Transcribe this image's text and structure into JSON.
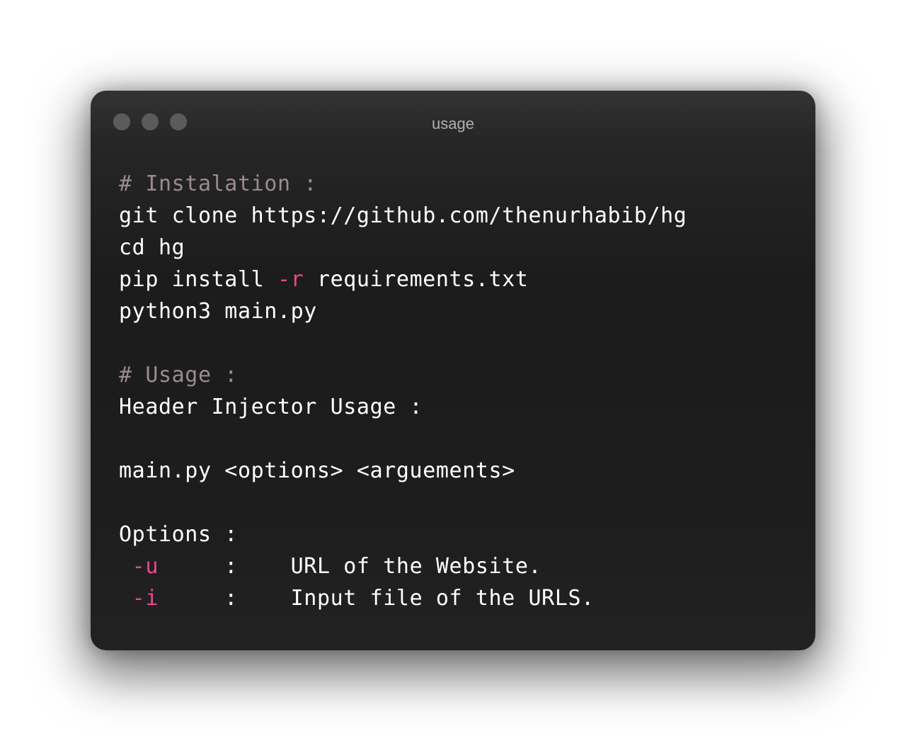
{
  "window": {
    "title": "usage",
    "controls": [
      "close",
      "minimize",
      "maximize"
    ]
  },
  "code": {
    "lines": [
      [
        {
          "kind": "comment",
          "text": "# Instalation :"
        }
      ],
      [
        {
          "kind": "plain",
          "text": "git clone https://github.com/thenurhabib/hg"
        }
      ],
      [
        {
          "kind": "plain",
          "text": "cd hg"
        }
      ],
      [
        {
          "kind": "plain",
          "text": "pip install "
        },
        {
          "kind": "flag",
          "text": "-r"
        },
        {
          "kind": "plain",
          "text": " requirements.txt"
        }
      ],
      [
        {
          "kind": "plain",
          "text": "python3 main.py"
        }
      ],
      [],
      [
        {
          "kind": "comment",
          "text": "# Usage :"
        }
      ],
      [
        {
          "kind": "plain",
          "text": "Header Injector Usage :"
        }
      ],
      [],
      [
        {
          "kind": "plain",
          "text": "main.py <options> <arguements>"
        }
      ],
      [],
      [
        {
          "kind": "plain",
          "text": "Options :"
        }
      ],
      [
        {
          "kind": "plain",
          "text": " "
        },
        {
          "kind": "flag",
          "text": "-u"
        },
        {
          "kind": "plain",
          "text": "     :    URL of the Website."
        }
      ],
      [
        {
          "kind": "plain",
          "text": " "
        },
        {
          "kind": "flag",
          "text": "-i"
        },
        {
          "kind": "plain",
          "text": "     :    Input file of the URLS."
        }
      ]
    ]
  },
  "colors": {
    "window_background": "#1c1c1c",
    "text": "#ffffff",
    "comment": "#9b8a90",
    "flag": "#e8488a",
    "title": "#b0b0b0",
    "window_dot": "#5b5b5b"
  }
}
